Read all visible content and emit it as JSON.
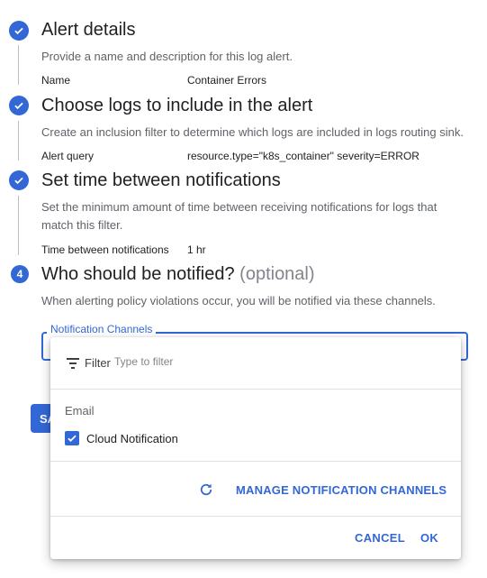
{
  "steps": [
    {
      "title": "Alert details",
      "description": "Provide a name and description for this log alert.",
      "field_label": "Name",
      "field_value": "Container Errors"
    },
    {
      "title": "Choose logs to include in the alert",
      "description": "Create an inclusion filter to determine which logs are included in logs routing sink.",
      "field_label": "Alert query",
      "field_value": "resource.type=\"k8s_container\" severity=ERROR"
    },
    {
      "title": "Set time between notifications",
      "description_line1": "Set the minimum amount of time between receiving notifications for logs that",
      "description_line2": "match this filter.",
      "field_label": "Time between notifications",
      "field_value": "1 hr"
    },
    {
      "number": "4",
      "title": "Who should be notified?",
      "title_optional": "(optional)",
      "description": "When alerting policy violations occur, you will be notified via these channels."
    }
  ],
  "notification_field": {
    "label": "Notification Channels"
  },
  "save_button": {
    "label": "SA"
  },
  "dropdown": {
    "filter_label": "Filter",
    "filter_placeholder": "Type to filter",
    "group_label": "Email",
    "options": [
      {
        "label": "Cloud Notification",
        "checked": true
      }
    ],
    "manage_link": "MANAGE NOTIFICATION CHANNELS",
    "cancel_label": "CANCEL",
    "ok_label": "OK"
  },
  "colors": {
    "accent": "#3367d6",
    "line": "#bdbdbd"
  },
  "icons": {
    "completed_step": "check-circle-icon",
    "filter": "filter-icon",
    "refresh": "refresh-icon",
    "checkbox": "checkbox-checked-icon"
  }
}
